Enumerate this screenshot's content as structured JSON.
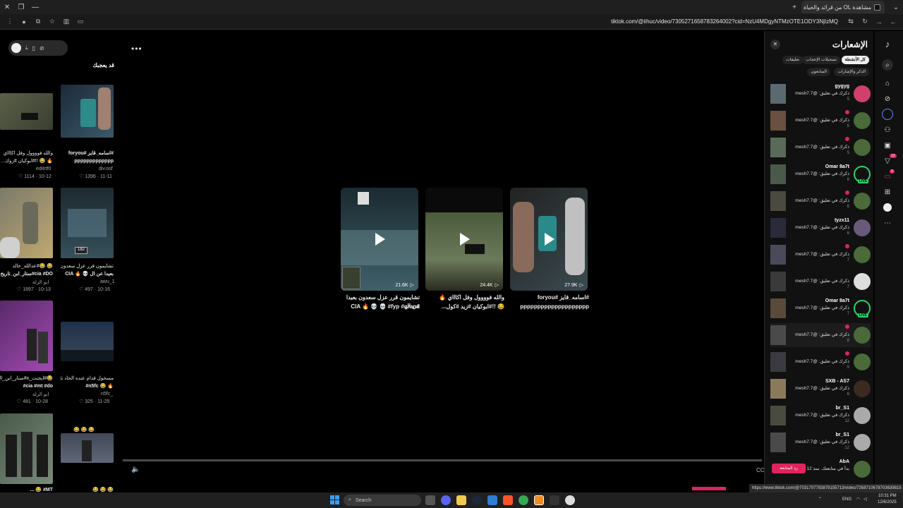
{
  "browser": {
    "tab_title": "مشاهدة OL من قرائد والحياة الوات...",
    "url": "tiktok.com/@iihuc/video/7305271658783264002?cid=NzU4MDgyNTMzOTE1ODY3NjIzMQ"
  },
  "left_toolbar": {
    "download": "⤓",
    "phone": "▯",
    "compass": "⊘"
  },
  "suggested": {
    "title": "قد يعجبك",
    "items": [
      {
        "caption": "#اسامه_قايز #foryou",
        "caption2": "ppppppppppppp",
        "meta": "11-11 · 1396 ♡",
        "author": "div.osf"
      },
      {
        "caption": "والله فوووول وفل اكاااي",
        "caption2": "🔥 😂 !!#ابوكيان #زوك...",
        "meta": "10-12 · 1114 ♡",
        "author": "editrtf0"
      },
      {
        "caption": "تشايمون قرر عزل سعدون",
        "caption2": "بعيدا عن ال 💀 🔥 CIA",
        "meta": "10-16 · 497 ♡",
        "author": "awu_1"
      },
      {
        "caption": "😂 😂#عدالله_خالد",
        "caption2": "cia #DO#ستار_ابن_تاريخ",
        "meta": "10-13 · 1897 ♡",
        "author": "ابو الزلة"
      },
      {
        "caption": "مسحول قدام عنده الحاد نا !!",
        "caption2": "🔥 😂 n5fc#",
        "meta": "11-25 · 325 ♡",
        "author": "_n5fc"
      },
      {
        "caption": "😂#ايجنت_x#ستار_ابن_الوين",
        "caption2": "cia #mt #do#",
        "meta": "10-28 · 481 ♡",
        "author": "ابو الزلة"
      }
    ],
    "bottom_row": [
      "😂 😂 😂",
      "MT# 😂 ..."
    ]
  },
  "center_cards": [
    {
      "views": "21.6K",
      "title": "تشايمون قرر عزل سعدون بعيدا عن ال",
      "title2": "CIA 🔥 💀 💀 #fyp #grand"
    },
    {
      "views": "24.4K",
      "title": "والله فوووول وفل اكاااي 🔥",
      "title2": "😂 !!#ابوكيان #زيد #كول..."
    },
    {
      "views": "27.9K",
      "title": "#اسامه_قايز #foryou",
      "title2": "pppppppppppppppppppp"
    }
  ],
  "player": {
    "cc_label": "CC"
  },
  "notifications": {
    "title": "الإشعارات",
    "close": "✕",
    "filters": [
      "كل الأنشطة",
      "تسجيلات الإعجاب",
      "تعليقات",
      "الذكر والإشارات",
      "المتابعون"
    ],
    "items": [
      {
        "name": "gygyg",
        "text": "ذكرك في تعليق: @mesh7.7",
        "count": "5"
      },
      {
        "name": "",
        "text": "ذكرك في تعليق: @mesh7.7",
        "count": "5"
      },
      {
        "name": "",
        "text": "ذكرك في تعليق: @mesh7.7",
        "count": "5"
      },
      {
        "name": "Omar 8a7t",
        "text": "ذكرك في تعليق: @mesh7.7",
        "count": "6"
      },
      {
        "name": "",
        "text": "ذكرك في تعليق: @mesh7.7",
        "count": "6"
      },
      {
        "name": "tyzx11",
        "text": "ذكرك في تعليق: @mesh7.7",
        "count": "6"
      },
      {
        "name": "",
        "text": "ذكرك في تعليق: @mesh7.7",
        "count": "7"
      },
      {
        "name": "",
        "text": "ذكرك في تعليق: @mesh7.7",
        "count": "7"
      },
      {
        "name": "Omar 8a7t",
        "text": "ذكرك في تعليق: @mesh7.7",
        "count": "7"
      },
      {
        "name": "",
        "text": "ذكرك في تعليق: @mesh7.7",
        "count": "8"
      },
      {
        "name": "",
        "text": "ذكرك في تعليق: @mesh7.7",
        "count": "9"
      },
      {
        "name": "SXB - AS7",
        "text": "ذكرك في تعليق: @mesh7.7",
        "count": "6"
      },
      {
        "name": "br_S1",
        "text": "ذكرك في تعليق: @mesh7.7",
        "count": "12"
      },
      {
        "name": "br_S1",
        "text": "ذكرك في تعليق: @mesh7.7",
        "count": "12"
      },
      {
        "name": "AbA",
        "text": "بدأ في متابعتك. منذ 12",
        "count": ""
      }
    ],
    "live_label": "LIVE",
    "follow_back": "رد المتابعة"
  },
  "rail": {
    "badge1": "12",
    "badge2": "3"
  },
  "status_url": "https://www.tiktok.com/@7031707793879155713/video/7358710678703639815",
  "taskbar": {
    "search": "Search",
    "lang": "ENG",
    "time": "10:31 PM",
    "date": "12/6/2025"
  },
  "colors": {
    "accent": "#e0245e",
    "live": "#2bd46a",
    "panel_bg": "#111111"
  }
}
